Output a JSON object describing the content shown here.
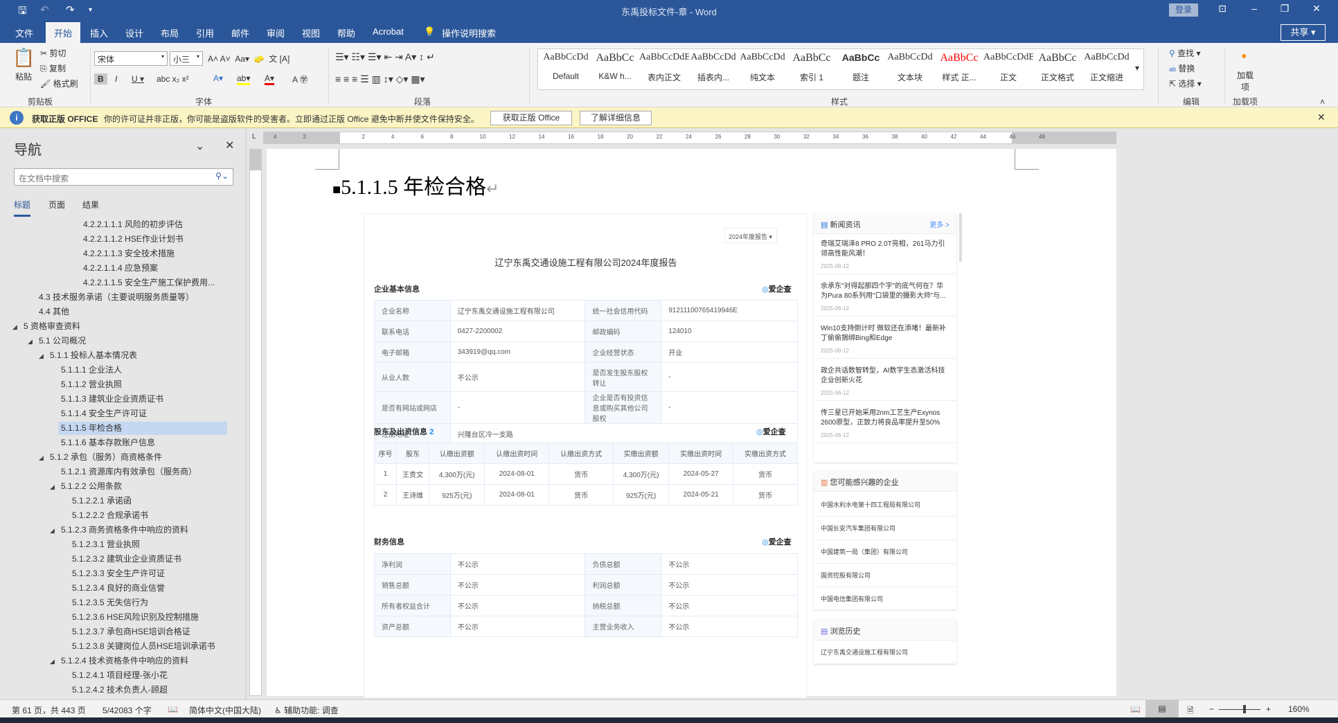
{
  "window": {
    "title": "东禹投标文件-章 - Word",
    "login": "登录",
    "share": "共享"
  },
  "tabs": [
    "文件",
    "开始",
    "插入",
    "设计",
    "布局",
    "引用",
    "邮件",
    "审阅",
    "视图",
    "帮助",
    "Acrobat"
  ],
  "tell_me": "操作说明搜索",
  "ribbon": {
    "clipboard": {
      "paste": "粘贴",
      "cut": "剪切",
      "copy": "复制",
      "format_painter": "格式刷",
      "label": "剪贴板"
    },
    "font": {
      "name": "宋体",
      "size": "小三",
      "label": "字体"
    },
    "paragraph": {
      "label": "段落"
    },
    "styles": {
      "label": "样式",
      "items": [
        {
          "preview": "AaBbCcDd",
          "name": "Default"
        },
        {
          "preview": "AaBbCc",
          "name": "K&W h..."
        },
        {
          "preview": "AaBbCcDdE",
          "name": "表内正文"
        },
        {
          "preview": "AaBbCcDd",
          "name": "插表内..."
        },
        {
          "preview": "AaBbCcDd",
          "name": "纯文本"
        },
        {
          "preview": "AaBbCc",
          "name": "索引 1"
        },
        {
          "preview": "AaBbCc",
          "name": "题注"
        },
        {
          "preview": "AaBbCcDd",
          "name": "文本块"
        },
        {
          "preview": "AaBbCc",
          "name": "样式 正..."
        },
        {
          "preview": "AaBbCcDdE",
          "name": "正文"
        },
        {
          "preview": "AaBbCc",
          "name": "正文格式"
        },
        {
          "preview": "AaBbCcDd",
          "name": "正文缩进"
        }
      ]
    },
    "editing": {
      "find": "查找",
      "replace": "替换",
      "select": "选择",
      "label": "编辑"
    },
    "addins": {
      "button": "加载项",
      "label": "加载项"
    }
  },
  "infobar": {
    "title": "获取正版 OFFICE",
    "message": "你的许可证并非正版，你可能是盗版软件的受害者。立即通过正版 Office 避免中断并使文件保持安全。",
    "btn_get": "获取正版 Office",
    "btn_more": "了解详细信息"
  },
  "nav": {
    "title": "导航",
    "search_placeholder": "在文档中搜索",
    "tabs": [
      "标题",
      "页面",
      "结果"
    ],
    "items": [
      {
        "text": "4.2.2.1.1.1 风险的初步评估",
        "level": 5
      },
      {
        "text": "4.2.2.1.1.2 HSE作业计划书",
        "level": 5
      },
      {
        "text": "4.2.2.1.1.3 安全技术措施",
        "level": 5
      },
      {
        "text": "4.2.2.1.1.4 应急预案",
        "level": 5
      },
      {
        "text": "4.2.2.1.1.5 安全生产施工保护费用...",
        "level": 5
      },
      {
        "text": "4.3 技术服务承诺（主要说明服务质量等）",
        "level": 1
      },
      {
        "text": "4.4 其他",
        "level": 1
      },
      {
        "text": "5 资格审查资料",
        "level": 0,
        "expanded": true
      },
      {
        "text": "5.1 公司概况",
        "level": 1,
        "expanded": true
      },
      {
        "text": "5.1.1 投标人基本情况表",
        "level": 2,
        "expanded": true
      },
      {
        "text": "5.1.1.1 企业法人",
        "level": 3
      },
      {
        "text": "5.1.1.2 营业执照",
        "level": 3
      },
      {
        "text": "5.1.1.3 建筑业企业资质证书",
        "level": 3
      },
      {
        "text": "5.1.1.4 安全生产许可证",
        "level": 3
      },
      {
        "text": "5.1.1.5 年检合格",
        "level": 3,
        "selected": true
      },
      {
        "text": "5.1.1.6 基本存款账户信息",
        "level": 3
      },
      {
        "text": "5.1.2 承包（服务）商资格条件",
        "level": 2,
        "expanded": true
      },
      {
        "text": "5.1.2.1 资源库内有效承包（服务商）",
        "level": 3
      },
      {
        "text": "5.1.2.2 公用条款",
        "level": 3,
        "expanded": true
      },
      {
        "text": "5.1.2.2.1 承诺函",
        "level": 4
      },
      {
        "text": "5.1.2.2.2 合规承诺书",
        "level": 4
      },
      {
        "text": "5.1.2.3 商务资格条件中响应的资料",
        "level": 3,
        "expanded": true
      },
      {
        "text": "5.1.2.3.1 营业执照",
        "level": 4
      },
      {
        "text": "5.1.2.3.2 建筑业企业资质证书",
        "level": 4
      },
      {
        "text": "5.1.2.3.3 安全生产许可证",
        "level": 4
      },
      {
        "text": "5.1.2.3.4 良好的商业信誉",
        "level": 4
      },
      {
        "text": "5.1.2.3.5 无失信行为",
        "level": 4
      },
      {
        "text": "5.1.2.3.6 HSE风险识别及控制措施",
        "level": 4
      },
      {
        "text": "5.1.2.3.7 承包商HSE培训合格证",
        "level": 4
      },
      {
        "text": "5.1.2.3.8 关键岗位人员HSE培训承诺书",
        "level": 4
      },
      {
        "text": "5.1.2.4 技术资格条件中响应的资料",
        "level": 3,
        "expanded": true
      },
      {
        "text": "5.1.2.4.1 项目经理-张小花",
        "level": 4
      },
      {
        "text": "5.1.2.4.2 技术负责人-顾超",
        "level": 4
      }
    ]
  },
  "ruler": {
    "marks": [
      "4",
      "2",
      "",
      "2",
      "4",
      "6",
      "8",
      "10",
      "12",
      "14",
      "16",
      "18",
      "20",
      "22",
      "24",
      "26",
      "28",
      "30",
      "32",
      "34",
      "36",
      "38",
      "40",
      "42",
      "44",
      "46",
      "48"
    ]
  },
  "document": {
    "heading": "5.1.1.5  年检合格",
    "report": {
      "year_select": "2024年度报告",
      "title": "辽宁东禹交通设施工程有限公司2024年度报告",
      "brand": "爱企查",
      "basic": {
        "title": "企业基本信息",
        "rows": [
          [
            "企业名称",
            "辽宁东禹交通设施工程有限公司",
            "统一社会信用代码",
            "91211100765419946E"
          ],
          [
            "联系电话",
            "0427-2200002",
            "邮政编码",
            "124010"
          ],
          [
            "电子邮箱",
            "343919@qq.com",
            "企业经营状态",
            "开业"
          ],
          [
            "从业人数",
            "不公示",
            "是否发生股东股权转让",
            "-"
          ],
          [
            "是否有网站或网店",
            "-",
            "企业是否有投资信息或购买其他公司股权",
            "-"
          ]
        ],
        "address_label": "注册地址",
        "address": "兴隆台区冷一支路"
      },
      "shareholders": {
        "title": "股东及出资信息",
        "count": "2",
        "headers": [
          "序号",
          "股东",
          "认缴出资额",
          "认缴出资时间",
          "认缴出资方式",
          "实缴出资额",
          "实缴出资时间",
          "实缴出资方式"
        ],
        "rows": [
          [
            "1",
            "王贵文",
            "4,300万(元)",
            "2024-08-01",
            "货币",
            "4,300万(元)",
            "2024-05-27",
            "货币"
          ],
          [
            "2",
            "王诗维",
            "925万(元)",
            "2024-08-01",
            "货币",
            "925万(元)",
            "2024-05-21",
            "货币"
          ]
        ]
      },
      "finance": {
        "title": "财务信息",
        "rows": [
          [
            "净利润",
            "不公示",
            "负债总额",
            "不公示"
          ],
          [
            "销售总额",
            "不公示",
            "利润总额",
            "不公示"
          ],
          [
            "所有者权益合计",
            "不公示",
            "纳税总额",
            "不公示"
          ],
          [
            "资产总额",
            "不公示",
            "主营业务收入",
            "不公示"
          ]
        ]
      }
    },
    "sidebar": {
      "news_title": "新闻资讯",
      "more": "更多 >",
      "news": [
        {
          "title": "奇瑞艾瑞泽8 PRO 2.0T亮相，261马力引领高性能风潮！",
          "date": "2025-06-12"
        },
        {
          "title": "余承东\"对得起那四个字\"的底气何在？华为Pura 80系列用\"口袋里的摄影大师\"与...",
          "date": "2025-06-12"
        },
        {
          "title": "Win10支持倒计时 微软还在添堵！最新补丁偷偷捆绑Bing和Edge",
          "date": "2025-06-12"
        },
        {
          "title": "政企共话数智转型，AI数字生态激活科技企业创新火花",
          "date": "2025-06-12"
        },
        {
          "title": "传三星已开始采用2nm工艺生产Exynos 2600原型，正致力将良品率提升至50%",
          "date": "2025-06-12"
        }
      ],
      "interest_title": "您可能感兴趣的企业",
      "interest": [
        "中国水利水电第十四工程局有限公司",
        "中国长安汽车集团有限公司",
        "中国建筑一局（集团）有限公司",
        "国资控股有限公司",
        "中国电信集团有限公司"
      ],
      "history_title": "浏览历史",
      "history": [
        "辽宁东禹交通设施工程有限公司"
      ]
    }
  },
  "status": {
    "page": "第 61 页，共 443 页",
    "words": "5/42083 个字",
    "language": "简体中文(中国大陆)",
    "accessibility": "辅助功能: 调查",
    "zoom": "160%",
    "zoom_percent": 160
  },
  "colors": {
    "word_blue": "#2b579a",
    "info_bg": "#fbf5c5",
    "nav_selected": "#c5d7f1"
  }
}
